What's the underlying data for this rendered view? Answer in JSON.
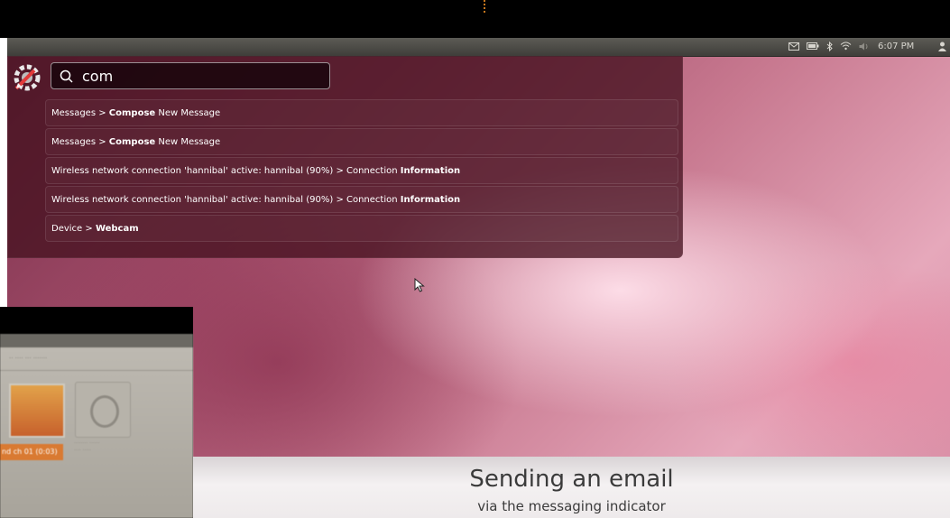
{
  "panel": {
    "clock": "6:07 PM"
  },
  "dash": {
    "search": {
      "value": "com"
    },
    "results": [
      {
        "prefix": "Messages > ",
        "bold": "Compose",
        "suffix": " New Message"
      },
      {
        "prefix": "Messages > ",
        "bold": "Compose",
        "suffix": " New Message"
      },
      {
        "prefix": "Wireless network connection 'hannibal' active: hannibal (90%) > Connection ",
        "bold": "Information",
        "suffix": ""
      },
      {
        "prefix": "Wireless network connection 'hannibal' active: hannibal (90%) > Connection ",
        "bold": "Information",
        "suffix": ""
      },
      {
        "prefix": "Device > ",
        "bold": "Webcam",
        "suffix": ""
      }
    ]
  },
  "thumbnail": {
    "selected_label": "nd ch 01 (0:03)"
  },
  "caption": {
    "title": "Sending an email",
    "subtitle": "via the messaging indicator"
  },
  "colors": {
    "panel": "#4e4d48",
    "dash_overlay": "#46121f",
    "selection": "#d97a32"
  },
  "icons": [
    "mail-icon",
    "battery-icon",
    "bluetooth-icon",
    "wifi-icon",
    "volume-icon",
    "user-icon",
    "bfb-logo-icon",
    "search-icon",
    "mouse-pointer-icon"
  ]
}
